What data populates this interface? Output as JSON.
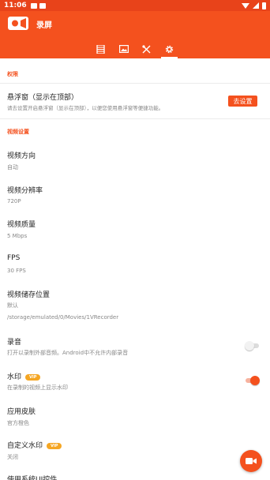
{
  "status_bar": {
    "time": "11:06",
    "icons": [
      "notification-icon",
      "notification-icon",
      "wifi-icon",
      "signal-icon",
      "battery-icon"
    ]
  },
  "app": {
    "title": "录屏",
    "logo_icon": "camera-logo-icon",
    "accent_color": "#f4511e"
  },
  "tabs": [
    {
      "icon": "film-icon",
      "active": false
    },
    {
      "icon": "image-icon",
      "active": false
    },
    {
      "icon": "tools-icon",
      "active": false
    },
    {
      "icon": "gear-icon",
      "active": true
    }
  ],
  "sections": {
    "permissions": "权限",
    "video_settings": "视频设置"
  },
  "settings": {
    "floating_window": {
      "title": "悬浮窗（显示在顶部）",
      "subtitle": "请去设置开启悬浮窗（显示在顶部），以便您使用悬浮窗等便捷功能。",
      "button": "去设置"
    },
    "orientation": {
      "title": "视频方向",
      "value": "自动"
    },
    "resolution": {
      "title": "视频分辨率",
      "value": "720P"
    },
    "quality": {
      "title": "视频质量",
      "value": "5 Mbps"
    },
    "fps": {
      "title": "FPS",
      "value": "30 FPS"
    },
    "storage": {
      "title": "视频储存位置",
      "value": "默认",
      "path": "/storage/emulated/0/Movies/1VRecorder"
    },
    "audio": {
      "title": "录音",
      "subtitle": "打开以录制外部音频。Android中不允许内部录音",
      "enabled": false
    },
    "watermark": {
      "title": "水印",
      "badge": "VIP",
      "subtitle": "在录制的视频上显示水印",
      "enabled": true
    },
    "skin": {
      "title": "应用皮肤",
      "value": "官方橙色"
    },
    "custom_watermark": {
      "title": "自定义水印",
      "badge": "VIP",
      "value": "关闭"
    },
    "partial": {
      "title": "使用系统UI控件"
    }
  },
  "fab": {
    "icon": "record-camera-icon"
  }
}
